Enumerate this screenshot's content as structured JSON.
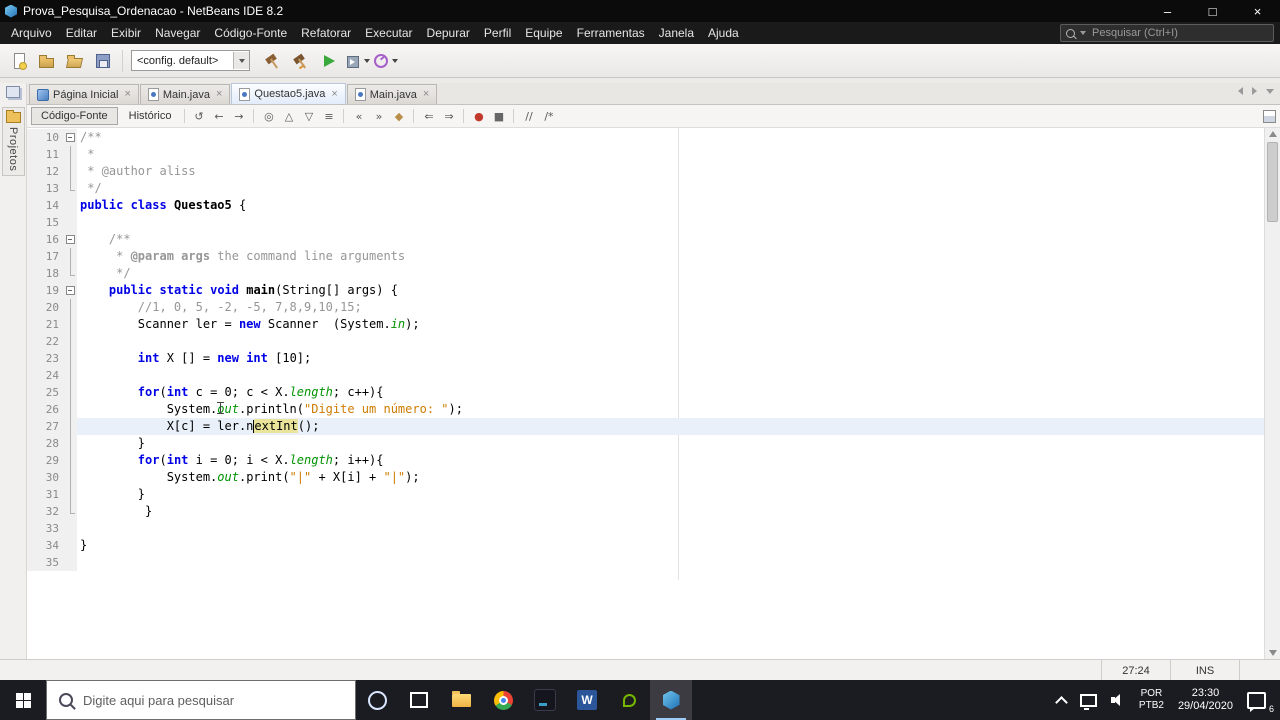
{
  "titlebar": {
    "title": "Prova_Pesquisa_Ordenacao - NetBeans IDE 8.2",
    "controls": {
      "minimize": "–",
      "maximize": "□",
      "close": "×"
    }
  },
  "menubar": {
    "items": [
      "Arquivo",
      "Editar",
      "Exibir",
      "Navegar",
      "Código-Fonte",
      "Refatorar",
      "Executar",
      "Depurar",
      "Perfil",
      "Equipe",
      "Ferramentas",
      "Janela",
      "Ajuda"
    ],
    "search_placeholder": "Pesquisar (Ctrl+I)"
  },
  "main_toolbar": {
    "config_value": "<config. default>",
    "buttons_left": [
      {
        "name": "new-file-icon"
      },
      {
        "name": "new-project-icon"
      },
      {
        "name": "open-project-icon"
      },
      {
        "name": "save-all-icon"
      }
    ],
    "buttons_right": [
      {
        "name": "build-project-icon"
      },
      {
        "name": "clean-build-icon"
      },
      {
        "name": "run-project-icon"
      },
      {
        "name": "debug-project-icon",
        "caret": true
      },
      {
        "name": "profile-project-icon",
        "caret": true
      }
    ]
  },
  "doc_tabs": {
    "close_glyph": "×",
    "tabs": [
      {
        "label": "Página Inicial",
        "icon": "start-page-icon",
        "active": false
      },
      {
        "label": "Main.java",
        "icon": "java-file-icon",
        "active": false
      },
      {
        "label": "Questao5.java",
        "icon": "java-file-icon",
        "active": true
      },
      {
        "label": "Main.java",
        "icon": "java-file-icon",
        "active": false
      }
    ]
  },
  "left_strip": {
    "window_label": "Projetos"
  },
  "editor_toolbar": {
    "source_label": "Código-Fonte",
    "history_label": "Histórico",
    "icon_groups": [
      [
        {
          "name": "last-edit-position-icon",
          "glyph": "↺"
        },
        {
          "name": "back-icon",
          "glyph": "←"
        },
        {
          "name": "forward-icon",
          "glyph": "→"
        }
      ],
      [
        {
          "name": "find-selection-icon",
          "glyph": "◎"
        },
        {
          "name": "find-previous-icon",
          "glyph": "△"
        },
        {
          "name": "find-next-icon",
          "glyph": "▽"
        },
        {
          "name": "toggle-highlight-search-icon",
          "glyph": "≡"
        }
      ],
      [
        {
          "name": "previous-bookmark-icon",
          "glyph": "«"
        },
        {
          "name": "next-bookmark-icon",
          "glyph": "»"
        },
        {
          "name": "toggle-bookmark-icon",
          "glyph": "◆",
          "color": "#b78f4a"
        }
      ],
      [
        {
          "name": "shift-line-left-icon",
          "glyph": "⇐"
        },
        {
          "name": "shift-line-right-icon",
          "glyph": "⇒"
        }
      ],
      [
        {
          "name": "start-macro-recording-icon",
          "glyph": "●",
          "color": "#c0392b"
        },
        {
          "name": "stop-macro-recording-icon",
          "glyph": "■",
          "color": "#666666"
        }
      ],
      [
        {
          "name": "comment-lines-icon",
          "glyph": "//"
        },
        {
          "name": "uncomment-lines-icon",
          "glyph": "/*"
        }
      ]
    ]
  },
  "editor": {
    "lines": [
      {
        "n": 10,
        "f": "s",
        "t": [
          [
            "c",
            "/**"
          ]
        ]
      },
      {
        "n": 11,
        "f": "l",
        "t": [
          [
            "c",
            " *"
          ]
        ]
      },
      {
        "n": 12,
        "f": "l",
        "t": [
          [
            "c",
            " * @author aliss"
          ]
        ]
      },
      {
        "n": 13,
        "f": "e",
        "t": [
          [
            "c",
            " */"
          ]
        ]
      },
      {
        "n": 14,
        "f": "",
        "t": [
          [
            "k",
            "public"
          ],
          [
            "p",
            " "
          ],
          [
            "k",
            "class"
          ],
          [
            "p",
            " "
          ],
          [
            "b",
            "Questao5"
          ],
          [
            "p",
            " {"
          ]
        ]
      },
      {
        "n": 15,
        "f": "",
        "t": []
      },
      {
        "n": 16,
        "f": "s",
        "t": [
          [
            "c",
            "    /**"
          ]
        ]
      },
      {
        "n": 17,
        "f": "l",
        "t": [
          [
            "c",
            "     * "
          ],
          [
            "cb",
            "@param args"
          ],
          [
            "c",
            " the command line arguments"
          ]
        ]
      },
      {
        "n": 18,
        "f": "e",
        "t": [
          [
            "c",
            "     */"
          ]
        ]
      },
      {
        "n": 19,
        "f": "s",
        "t": [
          [
            "p",
            "    "
          ],
          [
            "k",
            "public"
          ],
          [
            "p",
            " "
          ],
          [
            "k",
            "static"
          ],
          [
            "p",
            " "
          ],
          [
            "k",
            "void"
          ],
          [
            "p",
            " "
          ],
          [
            "b",
            "main"
          ],
          [
            "p",
            "(String[] args) {"
          ]
        ]
      },
      {
        "n": 20,
        "f": "l",
        "t": [
          [
            "p",
            "        "
          ],
          [
            "c",
            "//1, 0, 5, -2, -5, 7,8,9,10,15;"
          ]
        ]
      },
      {
        "n": 21,
        "f": "l",
        "t": [
          [
            "p",
            "        Scanner ler = "
          ],
          [
            "k",
            "new"
          ],
          [
            "p",
            " Scanner  (System."
          ],
          [
            "f",
            "in"
          ],
          [
            "p",
            ");"
          ]
        ]
      },
      {
        "n": 22,
        "f": "l",
        "t": []
      },
      {
        "n": 23,
        "f": "l",
        "t": [
          [
            "p",
            "        "
          ],
          [
            "k",
            "int"
          ],
          [
            "p",
            " X [] = "
          ],
          [
            "k",
            "new"
          ],
          [
            "p",
            " "
          ],
          [
            "k",
            "int"
          ],
          [
            "p",
            " [10];"
          ]
        ]
      },
      {
        "n": 24,
        "f": "l",
        "t": []
      },
      {
        "n": 25,
        "f": "l",
        "t": [
          [
            "p",
            "        "
          ],
          [
            "k",
            "for"
          ],
          [
            "p",
            "("
          ],
          [
            "k",
            "int"
          ],
          [
            "p",
            " c = 0; c < X."
          ],
          [
            "f",
            "length"
          ],
          [
            "p",
            "; c++){"
          ]
        ]
      },
      {
        "n": 26,
        "f": "l",
        "t": [
          [
            "p",
            "            System."
          ],
          [
            "f",
            "out"
          ],
          [
            "p",
            ".println("
          ],
          [
            "s",
            "\"Digite um número: \""
          ],
          [
            "p",
            ");"
          ]
        ]
      },
      {
        "n": 27,
        "f": "l",
        "cur": true,
        "t": [
          [
            "p",
            "            X[c] = ler.n"
          ],
          [
            "caret",
            ""
          ],
          [
            "hl",
            "extInt"
          ],
          [
            "p",
            "();"
          ]
        ]
      },
      {
        "n": 28,
        "f": "l",
        "t": [
          [
            "p",
            "        }"
          ]
        ]
      },
      {
        "n": 29,
        "f": "l",
        "t": [
          [
            "p",
            "        "
          ],
          [
            "k",
            "for"
          ],
          [
            "p",
            "("
          ],
          [
            "k",
            "int"
          ],
          [
            "p",
            " i = 0; i < X."
          ],
          [
            "f",
            "length"
          ],
          [
            "p",
            "; i++){"
          ]
        ]
      },
      {
        "n": 30,
        "f": "l",
        "t": [
          [
            "p",
            "            System."
          ],
          [
            "f",
            "out"
          ],
          [
            "p",
            ".print("
          ],
          [
            "s",
            "\"|\""
          ],
          [
            "p",
            " + X[i] + "
          ],
          [
            "s",
            "\"|\""
          ],
          [
            "p",
            ");"
          ]
        ]
      },
      {
        "n": 31,
        "f": "l",
        "t": [
          [
            "p",
            "        }"
          ]
        ]
      },
      {
        "n": 32,
        "f": "e",
        "t": [
          [
            "p",
            "         }"
          ]
        ]
      },
      {
        "n": 33,
        "f": "",
        "t": []
      },
      {
        "n": 34,
        "f": "",
        "t": [
          [
            "p",
            "}"
          ]
        ]
      },
      {
        "n": 35,
        "f": "",
        "t": []
      }
    ]
  },
  "statusbar": {
    "caret_position": "27:24",
    "insert_mode": "INS"
  },
  "taskbar": {
    "search_placeholder": "Digite aqui para pesquisar",
    "app_buttons": [
      {
        "name": "file-explorer-icon"
      },
      {
        "name": "chrome-icon"
      },
      {
        "name": "app-icon-dark"
      },
      {
        "name": "word-icon"
      },
      {
        "name": "nvidia-icon"
      },
      {
        "name": "netbeans-icon",
        "active": true
      }
    ],
    "tray": {
      "language_line1": "POR",
      "language_line2": "PTB2",
      "time": "23:30",
      "date": "29/04/2020",
      "notification_count": "6"
    }
  }
}
